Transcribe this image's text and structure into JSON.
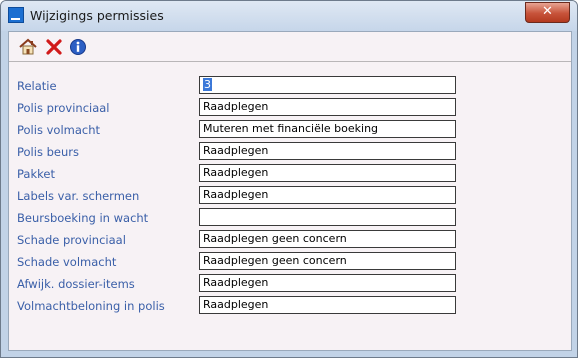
{
  "window": {
    "title": "Wijzigings permissies",
    "close_glyph": "✕"
  },
  "toolbar": {
    "icons": [
      "home-icon",
      "close-icon",
      "info-icon"
    ]
  },
  "form": {
    "rows": [
      {
        "label": "Relatie",
        "value": "3"
      },
      {
        "label": "Polis provinciaal",
        "value": "Raadplegen"
      },
      {
        "label": "Polis volmacht",
        "value": "Muteren met financiële boeking"
      },
      {
        "label": "Polis beurs",
        "value": "Raadplegen"
      },
      {
        "label": "Pakket",
        "value": "Raadplegen"
      },
      {
        "label": "Labels var. schermen",
        "value": "Raadplegen"
      },
      {
        "label": "Beursboeking in wacht",
        "value": ""
      },
      {
        "label": "Schade provinciaal",
        "value": "Raadplegen geen concern"
      },
      {
        "label": "Schade volmacht",
        "value": "Raadplegen geen concern"
      },
      {
        "label": "Afwijk. dossier-items",
        "value": "Raadplegen"
      },
      {
        "label": "Volmachtbeloning in polis",
        "value": "Raadplegen"
      }
    ]
  },
  "colors": {
    "label_text": "#3a5fa8",
    "selection": "#3b78d8",
    "close_button": "#c7533a"
  }
}
